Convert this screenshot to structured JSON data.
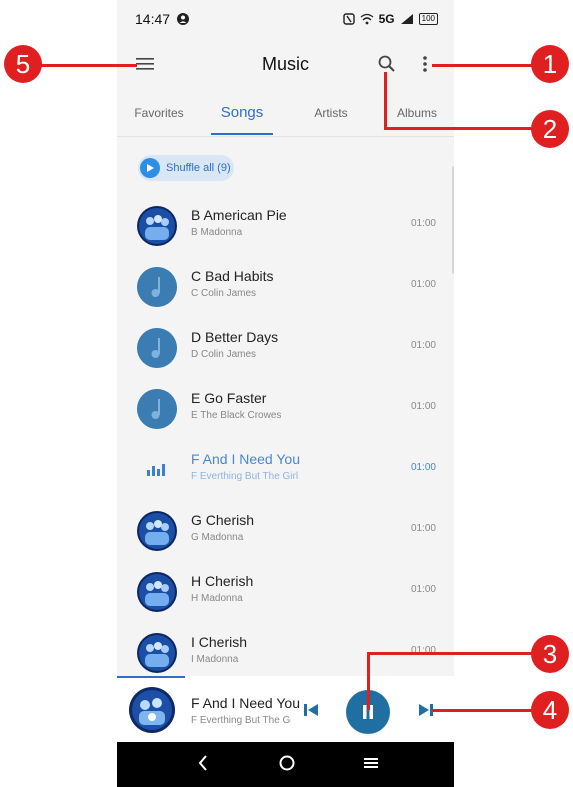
{
  "status_bar": {
    "time": "14:47",
    "network": "5G",
    "battery": "100"
  },
  "app_bar": {
    "title": "Music"
  },
  "tabs": [
    {
      "label": "Favorites"
    },
    {
      "label": "Songs"
    },
    {
      "label": "Artists"
    },
    {
      "label": "Albums"
    }
  ],
  "shuffle": {
    "label": "Shuffle all (9)"
  },
  "songs": [
    {
      "title": "B American Pie",
      "artist": "B Madonna",
      "duration": "01:00",
      "art": "photo"
    },
    {
      "title": "C Bad Habits",
      "artist": "C Colin James",
      "duration": "01:00",
      "art": "note"
    },
    {
      "title": "D Better Days",
      "artist": "D Colin James",
      "duration": "01:00",
      "art": "note"
    },
    {
      "title": "E Go Faster",
      "artist": "E The Black Crowes",
      "duration": "01:00",
      "art": "note"
    },
    {
      "title": "F And I Need You",
      "artist": "F Everthing But The Girl",
      "duration": "01:00",
      "art": "equalizer"
    },
    {
      "title": "G Cherish",
      "artist": "G Madonna",
      "duration": "01:00",
      "art": "photo"
    },
    {
      "title": "H Cherish",
      "artist": "H Madonna",
      "duration": "01:00",
      "art": "photo"
    },
    {
      "title": "I Cherish",
      "artist": "I Madonna",
      "duration": "01:00",
      "art": "photo"
    }
  ],
  "mini_player": {
    "title": "F And I Need You",
    "artist": "F Everthing But The Girl"
  },
  "callouts": [
    "1",
    "2",
    "3",
    "4",
    "5"
  ],
  "colors": {
    "accent": "#2f6dc9",
    "callout": "#e02020",
    "play_button": "#1f6fa3"
  }
}
